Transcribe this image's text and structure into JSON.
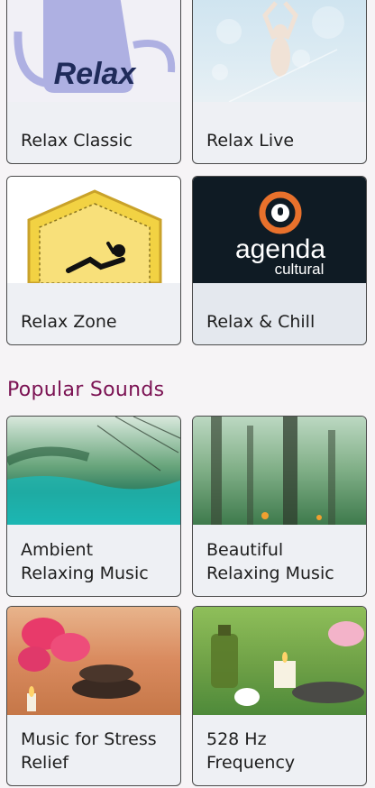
{
  "stations": {
    "items": [
      {
        "label": "Relax Classic",
        "logo_text": "Relax"
      },
      {
        "label": "Relax Live"
      },
      {
        "label": "Relax Zone"
      },
      {
        "label": "Relax & Chill",
        "logo_main": "agenda",
        "logo_sub": "cultural"
      }
    ]
  },
  "popular_section": {
    "title": "Popular Sounds"
  },
  "sounds": {
    "items": [
      {
        "label": "Ambient\nRelaxing Music"
      },
      {
        "label": "Beautiful\nRelaxing Music"
      },
      {
        "label": "Music for Stress\nRelief"
      },
      {
        "label": "528 Hz\nFrequency"
      }
    ]
  },
  "colors": {
    "accent": "#7b1253",
    "card_border": "#4a4a4a",
    "background": "#f6f4f6",
    "logo_orange": "#e8712c"
  }
}
